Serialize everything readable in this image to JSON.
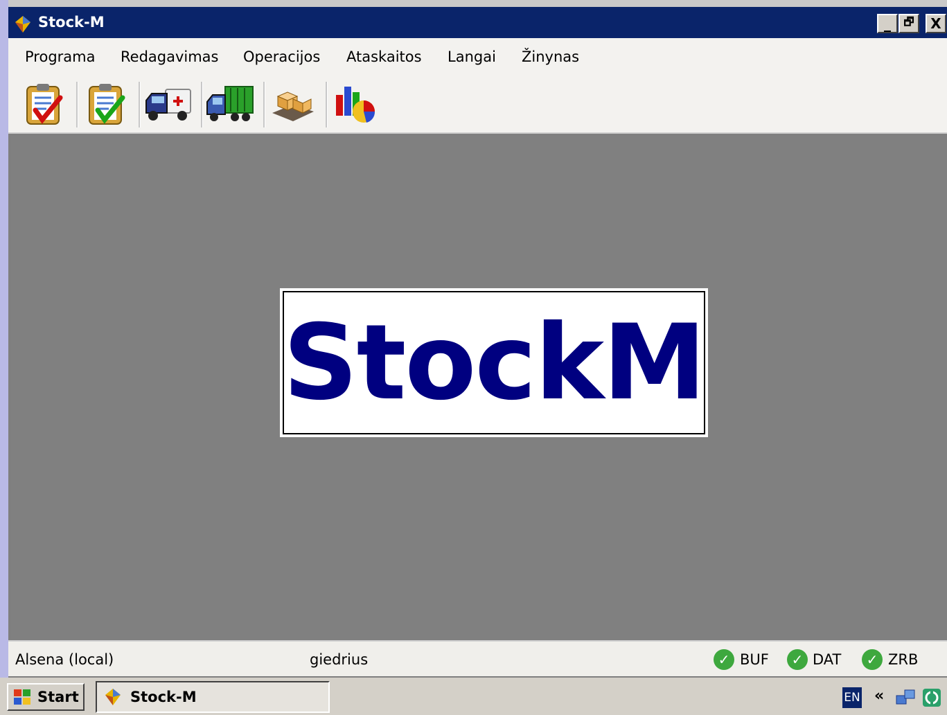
{
  "window": {
    "title": "Stock-M",
    "controls": {
      "minimize": "_",
      "restore": "🗗",
      "close": "X"
    }
  },
  "menu": {
    "items": [
      {
        "label": "Programa"
      },
      {
        "label": "Redagavimas"
      },
      {
        "label": "Operacijos"
      },
      {
        "label": "Ataskaitos"
      },
      {
        "label": "Langai"
      },
      {
        "label": "Žinynas"
      }
    ]
  },
  "toolbar": {
    "buttons": [
      {
        "icon": "clipboard-red-check-icon"
      },
      {
        "icon": "clipboard-green-check-icon"
      },
      {
        "icon": "ambulance-truck-icon"
      },
      {
        "icon": "green-truck-icon"
      },
      {
        "icon": "boxes-pallet-icon"
      },
      {
        "icon": "charts-icon"
      }
    ]
  },
  "logo": {
    "text": "StockM",
    "color": "#000080"
  },
  "status": {
    "database": "Alsena (local)",
    "user": "giedrius",
    "indicators": [
      {
        "label": "BUF",
        "state": "ok"
      },
      {
        "label": "DAT",
        "state": "ok"
      },
      {
        "label": "ZRB",
        "state": "ok"
      }
    ]
  },
  "taskbar": {
    "start_label": "Start",
    "task_label": "Stock-M",
    "language": "EN",
    "chevron": "«"
  },
  "colors": {
    "titlebar": "#0a246a",
    "mdi_background": "#808080",
    "ok_green": "#3ea83e"
  }
}
